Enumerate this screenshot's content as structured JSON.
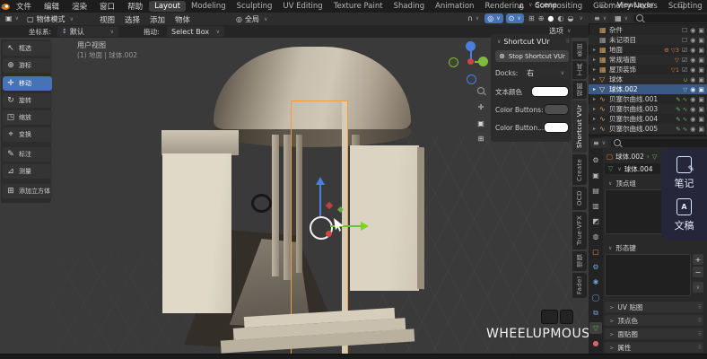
{
  "topbar": {
    "menus": [
      {
        "label": "文件"
      },
      {
        "label": "编辑"
      },
      {
        "label": "渲染"
      },
      {
        "label": "窗口"
      },
      {
        "label": "帮助"
      }
    ],
    "workspaces": [
      {
        "label": "Layout",
        "active": true
      },
      {
        "label": "Modeling"
      },
      {
        "label": "Sculpting"
      },
      {
        "label": "UV Editing"
      },
      {
        "label": "Texture Paint"
      },
      {
        "label": "Shading"
      },
      {
        "label": "Animation"
      },
      {
        "label": "Rendering"
      },
      {
        "label": "Compositing"
      },
      {
        "label": "Geometry Nodes"
      },
      {
        "label": "Scripting"
      },
      {
        "label": "+"
      }
    ],
    "scene": "Scene",
    "view_layer": "ViewLayer"
  },
  "header": {
    "mode": "物体模式",
    "menus": [
      {
        "label": "视图"
      },
      {
        "label": "选择"
      },
      {
        "label": "添加"
      },
      {
        "label": "物体"
      }
    ],
    "orientation": "全局",
    "options": "选项"
  },
  "tool_settings": {
    "orientation_label": "坐标系:",
    "orientation_value": "默认",
    "drag_label": "拖动:",
    "drag_value": "Select Box"
  },
  "toolbar": {
    "tools": [
      {
        "label": "框选",
        "glyph": "↖"
      },
      {
        "label": "游标",
        "glyph": "⊕"
      },
      {
        "label": "移动",
        "glyph": "✛",
        "active": true
      },
      {
        "label": "旋转",
        "glyph": "↻"
      },
      {
        "label": "缩放",
        "glyph": "◳"
      },
      {
        "label": "变换",
        "glyph": "⌖"
      },
      {
        "label": "标注",
        "glyph": "✎"
      },
      {
        "label": "测量",
        "glyph": "⊿"
      },
      {
        "label": "添加立方体",
        "glyph": "⊞"
      }
    ]
  },
  "viewport": {
    "view_label": "用户视图",
    "context_label": "(1) 地面 | 球体.002",
    "screencast_text": "WHEELUPMOUSE"
  },
  "npanel": {
    "title": "Shortcut VUr",
    "stop_button": "Stop Shortcut VUr",
    "docks_label": "Docks:",
    "docks_value": "右",
    "color_rows": [
      {
        "label": "文本颜色",
        "swatch": "#ffffff"
      },
      {
        "label": "Color Buttons:",
        "swatch": "#4f4f4f"
      },
      {
        "label": "Color Button...",
        "swatch": "#ffffff"
      }
    ],
    "tabs": [
      {
        "label": "条目"
      },
      {
        "label": "工具"
      },
      {
        "label": "视图"
      },
      {
        "label": "Shortcut VUr",
        "active": true
      },
      {
        "label": "Create"
      },
      {
        "label": "OCD"
      },
      {
        "label": "True-VFX"
      },
      {
        "label": "增强"
      },
      {
        "label": "Fade!"
      }
    ]
  },
  "outliner": {
    "rows": [
      {
        "label": "杂件",
        "type": "collection",
        "badge": ""
      },
      {
        "label": "未记项目",
        "type": "collection",
        "badge": ""
      },
      {
        "label": "地面",
        "type": "collection",
        "badge": "⚙ ▽3"
      },
      {
        "label": "常规墙面",
        "type": "collection",
        "badge": "▽"
      },
      {
        "label": "屋顶装饰",
        "type": "collection",
        "badge": "▽1"
      },
      {
        "label": "球体",
        "type": "mesh",
        "badge": "∪"
      },
      {
        "label": "球体.002",
        "type": "mesh",
        "badge": "▽",
        "selected": true
      },
      {
        "label": "贝塞尔曲线.001",
        "type": "curve",
        "badge": "✎ ∿"
      },
      {
        "label": "贝塞尔曲线.003",
        "type": "curve",
        "badge": "✎ ∿"
      },
      {
        "label": "贝塞尔曲线.004",
        "type": "curve",
        "badge": "✎ ∿"
      },
      {
        "label": "贝塞尔曲线.005",
        "type": "curve",
        "badge": "✎ ∿"
      }
    ]
  },
  "properties": {
    "breadcrumb_object": "球体.002",
    "breadcrumb_sep": "›",
    "data_name": "球体.004",
    "sections": [
      {
        "label": "顶点组",
        "expanded": true
      },
      {
        "label": "形态键",
        "expanded": true
      },
      {
        "label": "UV 贴图"
      },
      {
        "label": "顶点色"
      },
      {
        "label": "面贴图"
      },
      {
        "label": "属性"
      }
    ],
    "tabs": [
      {
        "name": "active-tool",
        "glyph": "⚙"
      },
      {
        "name": "render",
        "glyph": "▣"
      },
      {
        "name": "output",
        "glyph": "▤"
      },
      {
        "name": "view-layer",
        "glyph": "▥"
      },
      {
        "name": "scene",
        "glyph": "◩"
      },
      {
        "name": "world",
        "glyph": "◍"
      },
      {
        "name": "object",
        "glyph": "▢"
      },
      {
        "name": "modifiers",
        "glyph": "⚙"
      },
      {
        "name": "particles",
        "glyph": "✱"
      },
      {
        "name": "physics",
        "glyph": "◯"
      },
      {
        "name": "constraints",
        "glyph": "⧉"
      },
      {
        "name": "object-data",
        "glyph": "▽",
        "active": true
      },
      {
        "name": "material",
        "glyph": "●"
      }
    ]
  },
  "overlay": {
    "items": [
      {
        "label": "笔记"
      },
      {
        "label": "文稿"
      }
    ]
  },
  "icons": {
    "eye": "◉",
    "camera": "▣",
    "check_on": "☑",
    "check_off": "☐",
    "collection": "▦",
    "mesh": "▽",
    "curve": "∿",
    "caret": "∨",
    "expand": "▸",
    "funnel": "▽",
    "list": "≡",
    "viewport_editor": "▣",
    "magnet": "∩",
    "proportional": "◎",
    "pivot": "⊙",
    "shade_wire": "⊞",
    "shade_overlay": "⊕",
    "shade_solid": "●",
    "shade_material": "◐",
    "shade_render": "◒",
    "stop": "⊗",
    "pan": "✛",
    "camera_view": "▣",
    "ortho": "⊞",
    "orientation": "◎",
    "mode_cube": "▢",
    "plus": "+",
    "minus": "−",
    "breadcrumb_obj": "▢",
    "breadcrumb_data": "▽",
    "note_pen": "✎",
    "doc_a": "A"
  },
  "colors": {
    "accent": "#4772b3",
    "selection_outline": "#f09d3e",
    "viewport_bg": "#3a3a3a"
  }
}
